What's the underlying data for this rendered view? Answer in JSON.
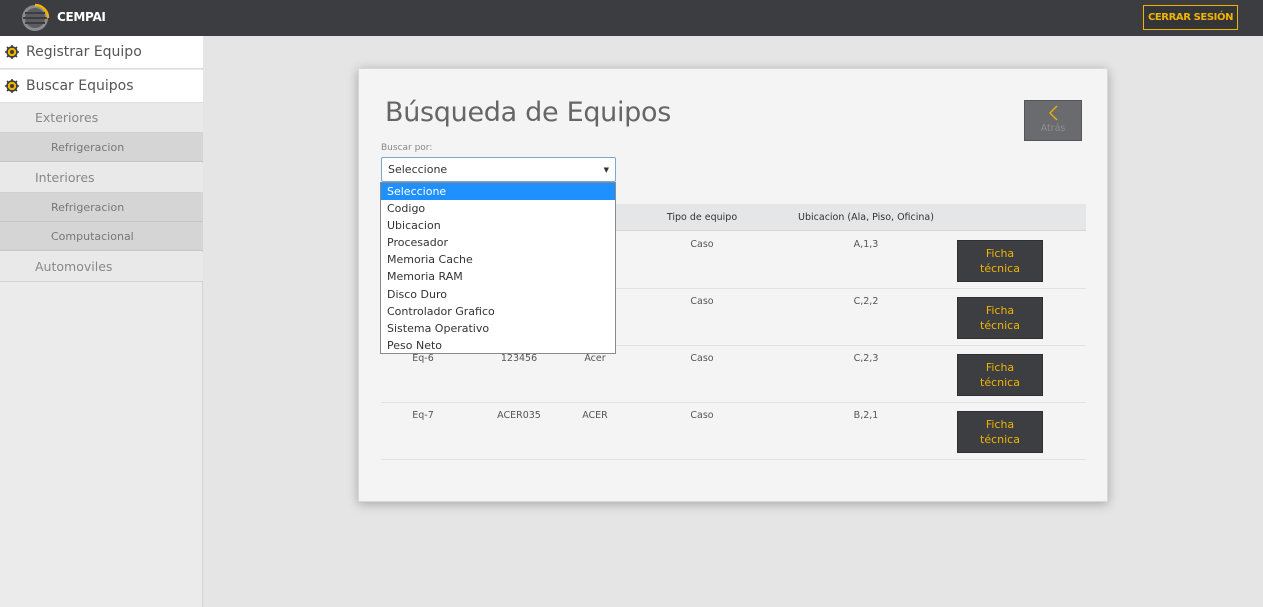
{
  "app": {
    "brand": "CEMPAI",
    "logout_label": "CERRAR SESIÓN"
  },
  "sidebar": {
    "main": [
      {
        "label": "Registrar Equipo"
      },
      {
        "label": "Buscar Equipos"
      }
    ],
    "sub": [
      {
        "label": "Exteriores"
      },
      {
        "label": "Refrigeracion"
      },
      {
        "label": "Interiores"
      },
      {
        "label": "Refrigeracion"
      },
      {
        "label": "Computacional"
      },
      {
        "label": "Automoviles"
      }
    ]
  },
  "main": {
    "title": "Búsqueda de Equipos",
    "back_label": "Atrás",
    "search_label": "Buscar por:",
    "select_value": "Seleccione",
    "dropdown_options": [
      "Seleccione",
      "Codigo",
      "Ubicacion",
      "Procesador",
      "Memoria Cache",
      "Memoria RAM",
      "Disco Duro",
      "Controlador Grafico",
      "Sistema Operativo",
      "Peso Neto"
    ],
    "table": {
      "headers": [
        "Tipo de equipo",
        "Ubicacion (Ala, Piso, Oficina)"
      ],
      "rows": [
        {
          "c1": "",
          "c2": "",
          "c3": "",
          "tipo": "Caso",
          "ubic": "A,1,3"
        },
        {
          "c1": "",
          "c2": "",
          "c3": "",
          "tipo": "Caso",
          "ubic": "C,2,2"
        },
        {
          "c1": "Eq-6",
          "c2": "123456",
          "c3": "Acer",
          "tipo": "Caso",
          "ubic": "C,2,3"
        },
        {
          "c1": "Eq-7",
          "c2": "ACER035",
          "c3": "ACER",
          "tipo": "Caso",
          "ubic": "B,2,1"
        }
      ],
      "ficha_label_1": "Ficha",
      "ficha_label_2": "técnica"
    }
  },
  "colors": {
    "accent": "#f0b400",
    "topbar": "#3b3d41",
    "selected_option": "#1e90ff"
  }
}
